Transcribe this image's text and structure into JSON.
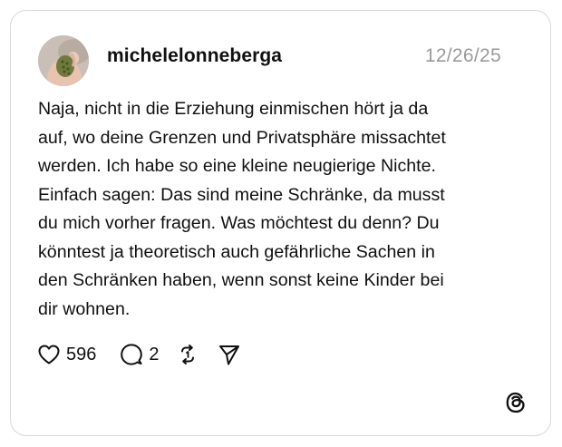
{
  "post": {
    "username": "michelelonneberga",
    "date": "12/26/25",
    "text": "Naja, nicht in die Erziehung einmischen hört ja da\nauf, wo deine Grenzen und Privatsphäre missachtet\nwerden. Ich habe so eine kleine neugierige Nichte.\nEinfach sagen: Das sind meine Schränke, da musst\ndu mich vorher fragen. Was möchtest du denn? Du\nkönntest ja theoretisch auch gefährliche Sachen in\nden Schränken haben, wenn sonst keine Kinder bei\ndir wohnen."
  },
  "actions": {
    "like_count": "596",
    "reply_count": "2",
    "like_icon": "heart-icon",
    "reply_icon": "speech-bubble-icon",
    "repost_icon": "repost-icon",
    "share_icon": "send-icon"
  },
  "branding": {
    "logo_icon": "threads-logo-icon"
  },
  "colors": {
    "text": "#101010",
    "muted": "#9a9a9a",
    "border": "#d9d9d9",
    "background": "#ffffff"
  }
}
